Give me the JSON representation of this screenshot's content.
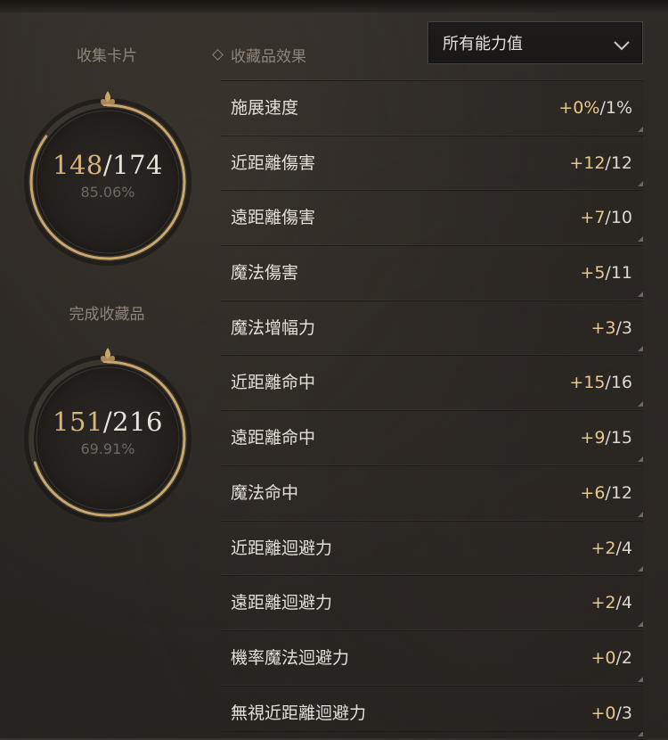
{
  "left": {
    "cards": {
      "label": "收集卡片",
      "current": "148",
      "separator": "/",
      "total": "174",
      "percent": "85.06%",
      "progress": 0.8506
    },
    "collections": {
      "label": "完成收藏品",
      "current": "151",
      "separator": "/",
      "total": "216",
      "percent": "69.91%",
      "progress": 0.6991
    }
  },
  "effects": {
    "header": "收藏品效果",
    "filter": {
      "selected": "所有能力值"
    },
    "items": [
      {
        "name": "施展速度",
        "current": "+0%",
        "rest": "/1%"
      },
      {
        "name": "近距離傷害",
        "current": "+12",
        "rest": "/12"
      },
      {
        "name": "遠距離傷害",
        "current": "+7",
        "rest": "/10"
      },
      {
        "name": "魔法傷害",
        "current": "+5",
        "rest": "/11"
      },
      {
        "name": "魔法增幅力",
        "current": "+3",
        "rest": "/3"
      },
      {
        "name": "近距離命中",
        "current": "+15",
        "rest": "/16"
      },
      {
        "name": "遠距離命中",
        "current": "+9",
        "rest": "/15"
      },
      {
        "name": "魔法命中",
        "current": "+6",
        "rest": "/12"
      },
      {
        "name": "近距離迴避力",
        "current": "+2",
        "rest": "/4"
      },
      {
        "name": "遠距離迴避力",
        "current": "+2",
        "rest": "/4"
      },
      {
        "name": "機率魔法迴避力",
        "current": "+0",
        "rest": "/2"
      },
      {
        "name": "無視近距離迴避力",
        "current": "+0",
        "rest": "/3"
      }
    ]
  },
  "colors": {
    "accent_gold": "#d7b57a",
    "value_gold": "#e7c88a",
    "ring_gold": "#c9a66a"
  }
}
